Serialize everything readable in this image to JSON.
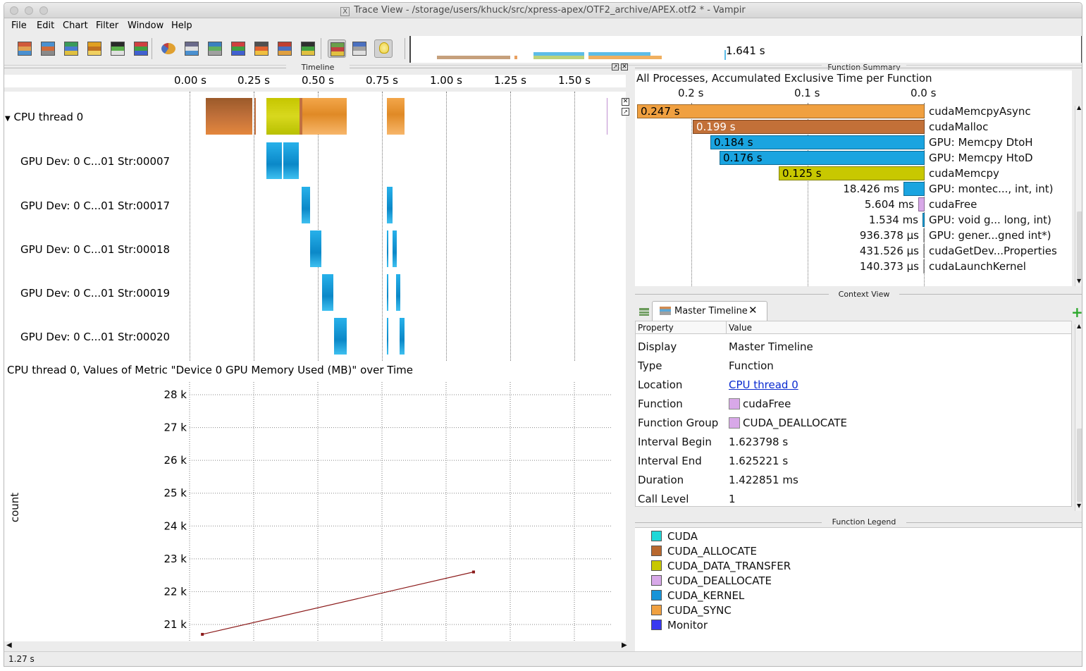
{
  "window": {
    "title": "Trace View - /storage/users/khuck/src/xpress-apex/OTF2_archive/APEX.otf2 * - Vampir"
  },
  "menu": {
    "items": [
      "File",
      "Edit",
      "Chart",
      "Filter",
      "Window",
      "Help"
    ]
  },
  "toolbar": {
    "icons": [
      "master-timeline-icon",
      "process-timeline-icon",
      "summary-timeline-icon",
      "performance-radar-icon",
      "counter-timeline-icon",
      "message-statistics-icon",
      "function-summary-icon",
      "message-summary-icon",
      "process-summary-icon",
      "communication-matrix-icon",
      "io-summary-icon",
      "call-tree-icon",
      "call-stack-icon",
      "filter-icon",
      "pin-icon",
      "lightbulb-icon"
    ],
    "overview_label": "1.641 s"
  },
  "timeline": {
    "panel_title": "Timeline",
    "ticks": [
      "0.00 s",
      "0.25 s",
      "0.50 s",
      "0.75 s",
      "1.00 s",
      "1.25 s",
      "1.50 s"
    ],
    "rows": [
      {
        "label": "CPU thread 0"
      },
      {
        "label": "GPU Dev: 0 C...01 Str:00007"
      },
      {
        "label": "GPU Dev: 0 C...01 Str:00017"
      },
      {
        "label": "GPU Dev: 0 C...01 Str:00018"
      },
      {
        "label": "GPU Dev: 0 C...01 Str:00019"
      },
      {
        "label": "GPU Dev: 0 C...01 Str:00020"
      }
    ]
  },
  "metric": {
    "title": "CPU thread 0, Values of Metric \"Device 0 GPU Memory Used (MB)\" over Time",
    "y_axis_name": "count",
    "y_ticks": [
      "28 k",
      "27 k",
      "26 k",
      "25 k",
      "24 k",
      "23 k",
      "22 k",
      "21 k"
    ]
  },
  "chart_data": {
    "type": "line",
    "ylabel": "count",
    "y_ticks": [
      28000,
      27000,
      26000,
      25000,
      24000,
      23000,
      22000,
      21000
    ],
    "ylim": [
      20700,
      28200
    ],
    "xlim": [
      0.0,
      1.65
    ],
    "series": [
      {
        "values": [
          {
            "x": 0.05,
            "y": 20700
          },
          {
            "x": 1.11,
            "y": 22600
          }
        ]
      }
    ],
    "color": "#8b1a1a"
  },
  "status": {
    "time": "1.27 s"
  },
  "function_summary": {
    "panel_title": "Function Summary",
    "header": "All Processes, Accumulated Exclusive Time per Function",
    "ticks": [
      "0.2 s",
      "0.1 s",
      "0.0 s"
    ],
    "rows": [
      {
        "name": "cudaMemcpyAsync",
        "value": "0.247 s",
        "seconds": 0.247,
        "color": "#f0a040"
      },
      {
        "name": "cudaMalloc",
        "value": "0.199 s",
        "seconds": 0.199,
        "color": "#c27038"
      },
      {
        "name": "GPU: Memcpy DtoH",
        "value": "0.184 s",
        "seconds": 0.184,
        "color": "#1aa4e0"
      },
      {
        "name": "GPU: Memcpy HtoD",
        "value": "0.176 s",
        "seconds": 0.176,
        "color": "#1aa4e0"
      },
      {
        "name": "cudaMemcpy",
        "value": "0.125 s",
        "seconds": 0.125,
        "color": "#c8c800"
      },
      {
        "name": "GPU: montec..., int, int)",
        "value": "18.426 ms",
        "seconds": 0.018426,
        "color": "#1aa4e0"
      },
      {
        "name": "cudaFree",
        "value": "5.604 ms",
        "seconds": 0.005604,
        "color": "#d8a8e8"
      },
      {
        "name": "GPU: void g... long, int)",
        "value": "1.534 ms",
        "seconds": 0.001534,
        "color": "#1aa4e0"
      },
      {
        "name": "GPU: gener...gned int*)",
        "value": "936.378 µs",
        "seconds": 0.000936,
        "color": "#1aa4e0"
      },
      {
        "name": "cudaGetDev...Properties",
        "value": "431.526 µs",
        "seconds": 0.000432,
        "color": "#f0a040"
      },
      {
        "name": "cudaLaunchKernel",
        "value": "140.373 µs",
        "seconds": 0.00014,
        "color": "#f0a040"
      }
    ]
  },
  "context_view": {
    "panel_title": "Context View",
    "tab_label": "Master Timeline",
    "col_property": "Property",
    "col_value": "Value",
    "rows": [
      {
        "property": "Display",
        "value": "Master Timeline"
      },
      {
        "property": "Type",
        "value": "Function"
      },
      {
        "property": "Location",
        "value": "CPU thread 0"
      },
      {
        "property": "Function",
        "value": "cudaFree"
      },
      {
        "property": "Function Group",
        "value": "CUDA_DEALLOCATE"
      },
      {
        "property": "Interval Begin",
        "value": "1.623798 s"
      },
      {
        "property": "Interval End",
        "value": "1.625221 s"
      },
      {
        "property": "Duration",
        "value": "1.422851 ms"
      },
      {
        "property": "Call Level",
        "value": "1"
      }
    ],
    "swatch_color": "#d8a8e8"
  },
  "function_legend": {
    "panel_title": "Function Legend",
    "items": [
      {
        "label": "CUDA",
        "color": "#20d8d8"
      },
      {
        "label": "CUDA_ALLOCATE",
        "color": "#b8682e"
      },
      {
        "label": "CUDA_DATA_TRANSFER",
        "color": "#c8c800"
      },
      {
        "label": "CUDA_DEALLOCATE",
        "color": "#d8a8e8"
      },
      {
        "label": "CUDA_KERNEL",
        "color": "#1894d8"
      },
      {
        "label": "CUDA_SYNC",
        "color": "#f0a040"
      },
      {
        "label": "Monitor",
        "color": "#3838f0"
      }
    ]
  }
}
